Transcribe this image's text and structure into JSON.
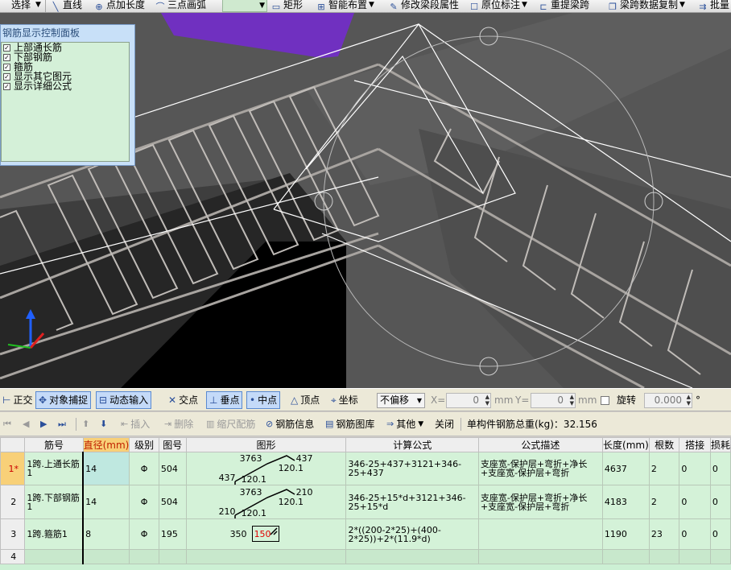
{
  "toolbar": {
    "items": [
      {
        "label": "选择",
        "icon": "pointer-icon"
      },
      {
        "label": "直线",
        "icon": "line-icon"
      },
      {
        "label": "点加长度",
        "icon": "point-length-icon"
      },
      {
        "label": "三点画弧",
        "icon": "arc-icon"
      },
      {
        "label": "矩形",
        "icon": "rectangle-icon"
      },
      {
        "label": "智能布置",
        "icon": "smart-layout-icon"
      },
      {
        "label": "修改梁段属性",
        "icon": "edit-beam-icon"
      },
      {
        "label": "原位标注",
        "icon": "annotation-icon"
      },
      {
        "label": "重提梁跨",
        "icon": "beam-span-icon"
      },
      {
        "label": "梁跨数据复制",
        "icon": "copy-icon"
      },
      {
        "label": "批量",
        "icon": "batch-icon"
      }
    ]
  },
  "panel": {
    "title": "钢筋显示控制面板",
    "options": [
      {
        "label": "上部通长筋",
        "checked": true
      },
      {
        "label": "下部钢筋",
        "checked": true
      },
      {
        "label": "箍筋",
        "checked": true
      },
      {
        "label": "显示其它图元",
        "checked": true
      },
      {
        "label": "显示详细公式",
        "checked": true
      }
    ]
  },
  "snapbar": {
    "ortho": "正交",
    "object_snap": "对象捕捉",
    "dynamic_input": "动态输入",
    "intersection": "交点",
    "perpendicular": "垂点",
    "midpoint": "中点",
    "vertex": "顶点",
    "coordinate": "坐标",
    "offset_mode": "不偏移",
    "x_label": "X=",
    "x_value": "0",
    "x_unit": "mm",
    "y_label": "Y=",
    "y_value": "0",
    "y_unit": "mm",
    "rotate_label": "旋转",
    "rotate_value": "0.000",
    "degree_symbol": "°"
  },
  "rebarbar": {
    "insert": "插入",
    "delete": "删除",
    "scale_rebar": "缩尺配筋",
    "rebar_info": "钢筋信息",
    "rebar_library": "钢筋图库",
    "other": "其他",
    "close": "关闭",
    "total_weight": "单构件钢筋总重(kg)：32.156"
  },
  "grid": {
    "headers": [
      "筋号",
      "直径(mm)",
      "级别",
      "图号",
      "图形",
      "计算公式",
      "公式描述",
      "长度(mm)",
      "根数",
      "搭接",
      "损耗"
    ],
    "rows": [
      {
        "row_no": "1*",
        "name": "1跨.上通长筋1",
        "diameter": "14",
        "grade": "Φ",
        "fig_no": "504",
        "shape_top": "3763",
        "shape_right": "437",
        "shape_mid": "120.1",
        "shape_left": "437",
        "shape_bottom": "120.1",
        "formula": "346-25+437+3121+346-25+437",
        "description": "支座宽-保护层+弯折+净长+支座宽-保护层+弯折",
        "length": "4637",
        "count": "2",
        "lap": "0",
        "loss": "0"
      },
      {
        "row_no": "2",
        "name": "1跨.下部钢筋1",
        "diameter": "14",
        "grade": "Φ",
        "fig_no": "504",
        "shape_top": "3763",
        "shape_right": "210",
        "shape_mid": "120.1",
        "shape_left": "210",
        "shape_bottom": "120.1",
        "formula": "346-25+15*d+3121+346-25+15*d",
        "description": "支座宽-保护层+弯折+净长+支座宽-保护层+弯折",
        "length": "4183",
        "count": "2",
        "lap": "0",
        "loss": "0"
      },
      {
        "row_no": "3",
        "name": "1跨.箍筋1",
        "diameter": "8",
        "grade": "Φ",
        "fig_no": "195",
        "shape_left": "350",
        "shape_box": "150",
        "formula": "2*((200-2*25)+(400-2*25))+2*(11.9*d)",
        "description": "",
        "length": "1190",
        "count": "23",
        "lap": "0",
        "loss": "0"
      },
      {
        "row_no": "4"
      }
    ]
  },
  "colors": {
    "viewport_bg": "#565656",
    "grid_bg": "#d4f2d8",
    "header_highlight": "#f8d078",
    "purple_element": "#7030c0"
  }
}
